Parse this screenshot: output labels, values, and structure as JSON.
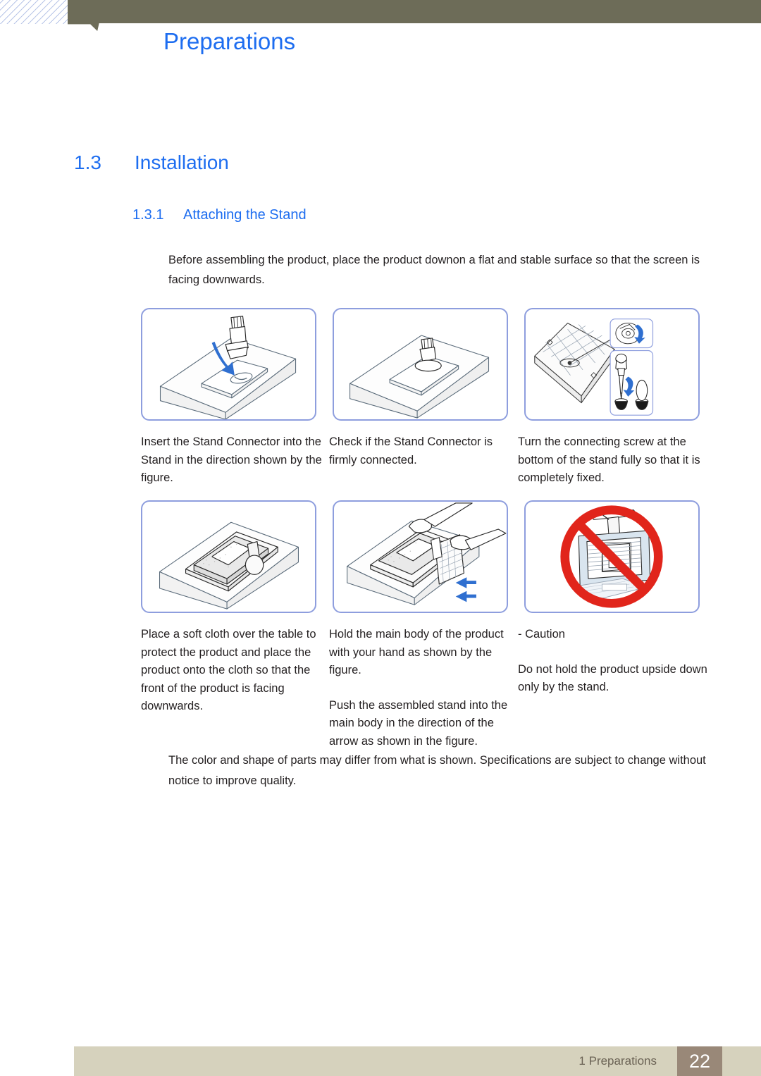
{
  "header": {
    "chapter_title": "Preparations",
    "bar_color": "#6d6c58",
    "accent_color": "#1d6df0"
  },
  "headings": {
    "section_number": "1.3",
    "section_title": "Installation",
    "subsection_number": "1.3.1",
    "subsection_title": "Attaching the Stand"
  },
  "intro": "Before assembling the product, place the product downon a flat and stable surface so that the screen is facing downwards.",
  "figures": {
    "row1": [
      {
        "name": "insert-stand-connector"
      },
      {
        "name": "check-stand-connector"
      },
      {
        "name": "turn-connecting-screw"
      }
    ],
    "row2": [
      {
        "name": "place-soft-cloth"
      },
      {
        "name": "push-stand-into-body"
      },
      {
        "name": "caution-do-not-hold-upside-down"
      }
    ]
  },
  "captions": {
    "row1": [
      {
        "paragraphs": [
          "Insert the Stand Connector into the Stand in the direction shown by the figure."
        ]
      },
      {
        "paragraphs": [
          "Check if the Stand Connector is firmly connected."
        ]
      },
      {
        "paragraphs": [
          "Turn the connecting screw at the bottom of the stand fully so that it is completely fixed."
        ]
      }
    ],
    "row2": [
      {
        "paragraphs": [
          "Place a soft cloth over the table to protect the product and place the product onto the cloth so that the front of the product is facing downwards."
        ]
      },
      {
        "paragraphs": [
          "Hold the main body of the product with your hand as shown by the figure.",
          "Push the assembled stand into the main body in the direction of the arrow as shown in the figure."
        ]
      },
      {
        "paragraphs": [
          "- Caution",
          "Do not hold the product upside down only by the stand."
        ]
      }
    ]
  },
  "note": "The color and shape of parts may differ from what is shown. Specifications are subject to change without notice to improve quality.",
  "footer": {
    "label": "1 Preparations",
    "page_number": "22",
    "bar_color": "#d6d2bd",
    "page_box_color": "#998878"
  }
}
